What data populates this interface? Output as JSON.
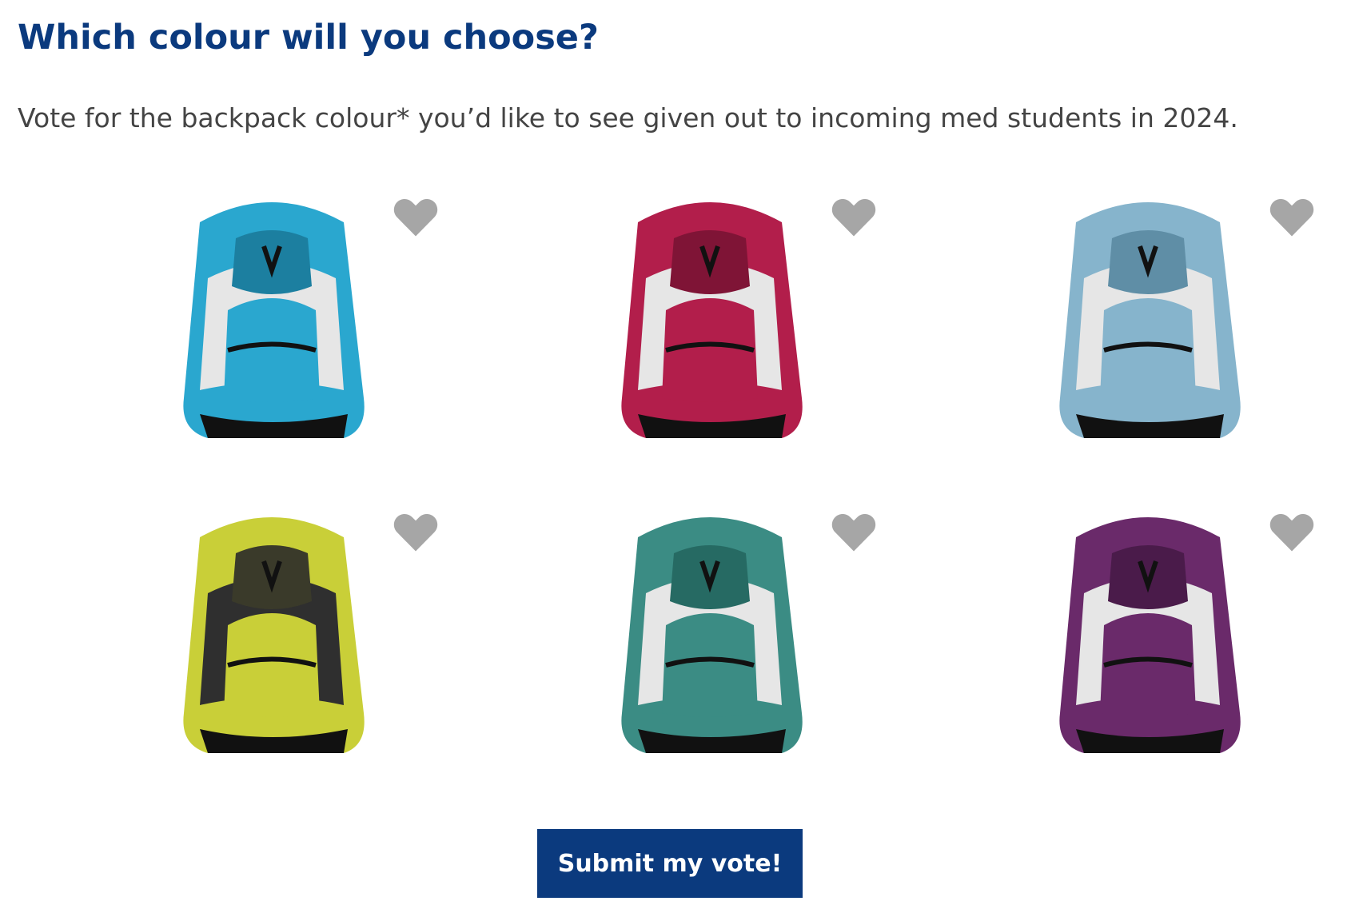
{
  "page": {
    "title": "Which colour will you choose?",
    "subtitle": "Vote for the backpack colour* you’d like to see given out to incoming med students in 2024."
  },
  "options": [
    {
      "color": "#2aa7cf",
      "dark": "#1c7fa0",
      "icon": "heart-icon"
    },
    {
      "color": "#b21e4b",
      "dark": "#7f1436",
      "icon": "heart-icon"
    },
    {
      "color": "#86b4cc",
      "dark": "#5f8ea6",
      "icon": "heart-icon"
    },
    {
      "color": "#c9cf38",
      "dark": "#3a3a2a",
      "icon": "heart-icon"
    },
    {
      "color": "#3b8c84",
      "dark": "#266a63",
      "icon": "heart-icon"
    },
    {
      "color": "#6a2a6a",
      "dark": "#4a1b4a",
      "icon": "heart-icon"
    }
  ],
  "actions": {
    "submit_label": "Submit my vote!"
  },
  "colors": {
    "heading": "#0b3a7e",
    "text": "#444444",
    "heart": "#a6a6a6",
    "button_bg": "#0b3a7e",
    "button_text": "#ffffff"
  }
}
